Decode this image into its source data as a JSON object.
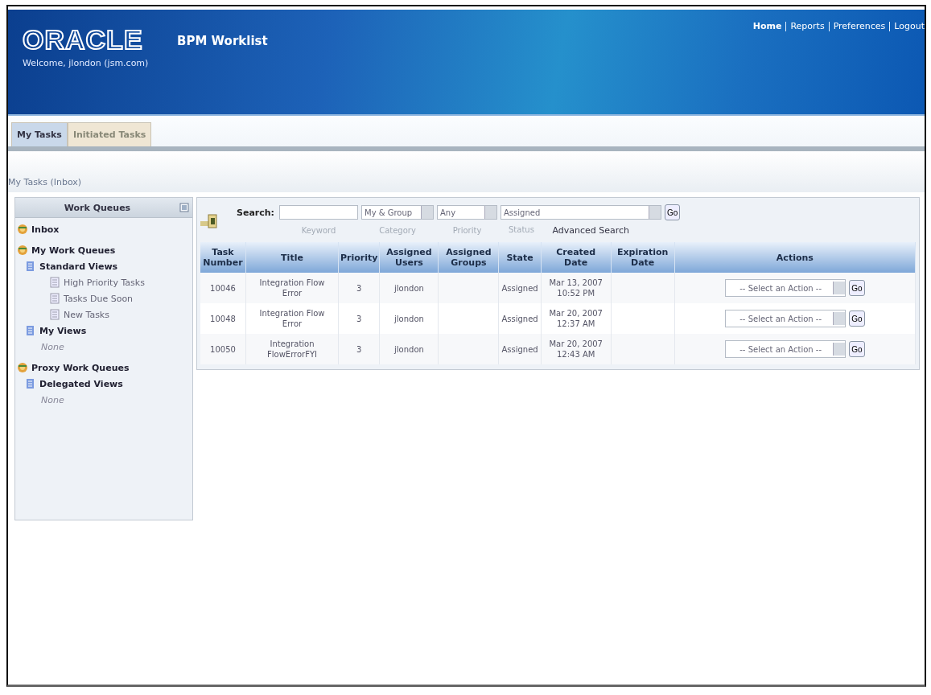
{
  "header": {
    "logo": "ORACLE",
    "app_title": "BPM Worklist",
    "welcome": "Welcome, jlondon (jsm.com)",
    "links": [
      "Home",
      "Reports",
      "Preferences",
      "Logout"
    ]
  },
  "tabs": [
    {
      "label": "My Tasks",
      "selected": true
    },
    {
      "label": "Initiated Tasks",
      "selected": false
    }
  ],
  "breadcrumb": "My Tasks (Inbox)",
  "sidebar": {
    "title": "Work Queues",
    "items": [
      {
        "kind": "queue",
        "label": "Inbox"
      },
      {
        "kind": "queue",
        "label": "My Work Queues",
        "children": [
          {
            "kind": "group",
            "label": "Standard Views",
            "children": [
              {
                "kind": "view",
                "label": "High Priority Tasks"
              },
              {
                "kind": "view",
                "label": "Tasks Due Soon"
              },
              {
                "kind": "view",
                "label": "New Tasks"
              }
            ]
          },
          {
            "kind": "group",
            "label": "My Views",
            "children": [
              {
                "kind": "empty",
                "label": "None"
              }
            ]
          }
        ]
      },
      {
        "kind": "queue",
        "label": "Proxy Work Queues",
        "children": [
          {
            "kind": "group",
            "label": "Delegated Views",
            "children": [
              {
                "kind": "empty",
                "label": "None"
              }
            ]
          }
        ]
      }
    ]
  },
  "search": {
    "label": "Search:",
    "filters": [
      {
        "value": "My & Group",
        "caption": "Category"
      },
      {
        "value": "Any",
        "caption": "Priority"
      },
      {
        "value": "Assigned",
        "caption": "Status"
      }
    ],
    "keyword_caption": "Keyword",
    "go": "Go",
    "advanced": "Advanced Search"
  },
  "table": {
    "columns": [
      "Task Number",
      "Title",
      "Priority",
      "Assigned Users",
      "Assigned Groups",
      "State",
      "Created Date",
      "Expiration Date",
      "Actions"
    ],
    "rows": [
      {
        "number": "10046",
        "title": "Integration Flow Error",
        "priority": "3",
        "users": "jlondon",
        "state": "Assigned",
        "created": "Mar 13, 2007 10:52 PM",
        "action": "-- Select an Action --",
        "go": "Go"
      },
      {
        "number": "10048",
        "title": "Integration Flow Error",
        "priority": "3",
        "users": "jlondon",
        "state": "Assigned",
        "created": "Mar 20, 2007 12:37 AM",
        "action": "-- Select an Action --",
        "go": "Go"
      },
      {
        "number": "10050",
        "title": "Integration FlowErrorFYI",
        "priority": "3",
        "users": "jlondon",
        "state": "Assigned",
        "created": "Mar 20, 2007 12:43 AM",
        "action": "-- Select an Action --",
        "go": "Go"
      }
    ]
  }
}
